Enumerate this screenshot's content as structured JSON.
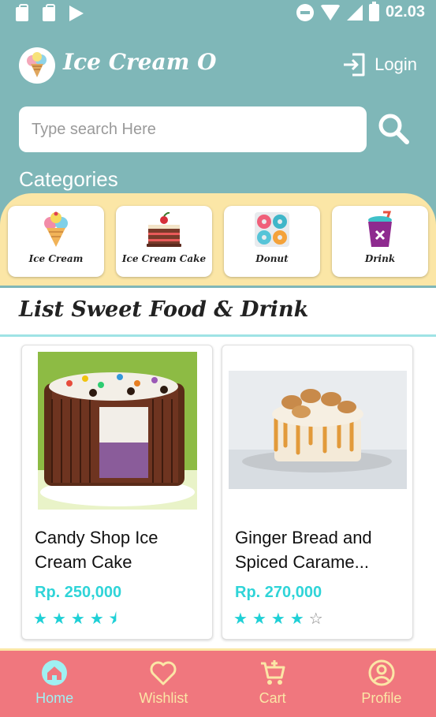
{
  "status_bar": {
    "time": "02.03",
    "left_icons": [
      "shopping-bag-icon",
      "shopping-bag-icon",
      "play-store-icon"
    ],
    "right_icons": [
      "do-not-disturb-icon",
      "wifi-icon",
      "signal-icon",
      "battery-charging-icon"
    ]
  },
  "header": {
    "app_title": "Ice Cream O",
    "login_label": "Login"
  },
  "search": {
    "placeholder": "Type search Here"
  },
  "categories": {
    "title": "Categories",
    "items": [
      {
        "label": "Ice Cream",
        "icon": "ice-cream-icon"
      },
      {
        "label": "Ice Cream Cake",
        "icon": "cake-icon"
      },
      {
        "label": "Donut",
        "icon": "donut-icon"
      },
      {
        "label": "Drink",
        "icon": "drink-icon"
      }
    ]
  },
  "list": {
    "title": "List Sweet Food & Drink",
    "products": [
      {
        "name": "Candy Shop Ice Cream Cake",
        "price": "Rp. 250,000",
        "rating": 4.5
      },
      {
        "name": "Ginger Bread and Spiced Carame...",
        "price": "Rp. 270,000",
        "rating": 4
      }
    ]
  },
  "bottom_nav": {
    "items": [
      {
        "label": "Home",
        "icon": "home-icon",
        "active": true
      },
      {
        "label": "Wishlist",
        "icon": "heart-icon",
        "active": false
      },
      {
        "label": "Cart",
        "icon": "cart-icon",
        "active": false
      },
      {
        "label": "Profile",
        "icon": "profile-icon",
        "active": false
      }
    ]
  },
  "colors": {
    "header_bg": "#7fb7b8",
    "category_strip": "#fbe6a6",
    "accent": "#2fd4d8",
    "nav_bg": "#f0777e",
    "nav_text": "#fbe6a6",
    "nav_active": "#9ff0f2"
  }
}
